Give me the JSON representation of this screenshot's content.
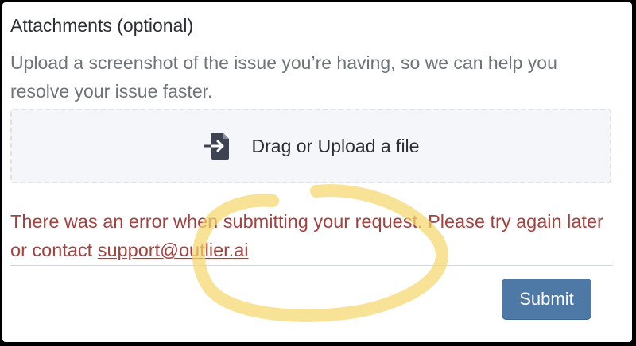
{
  "attachments": {
    "title": "Attachments (optional)",
    "helper_text": "Upload a screenshot of the issue you’re having, so we can help you resolve your issue faster.",
    "dropzone_label": "Drag or Upload a file",
    "dropzone_icon": "file-upload-icon"
  },
  "error": {
    "message": "There was an error when submitting your request. Please try again later or contact ",
    "link_text": "support@outlier.ai",
    "color": "#a5403f"
  },
  "form": {
    "submit_label": "Submit",
    "submit_color": "#4e79a7"
  },
  "annotation": {
    "highlight_color": "#f5d76e"
  }
}
